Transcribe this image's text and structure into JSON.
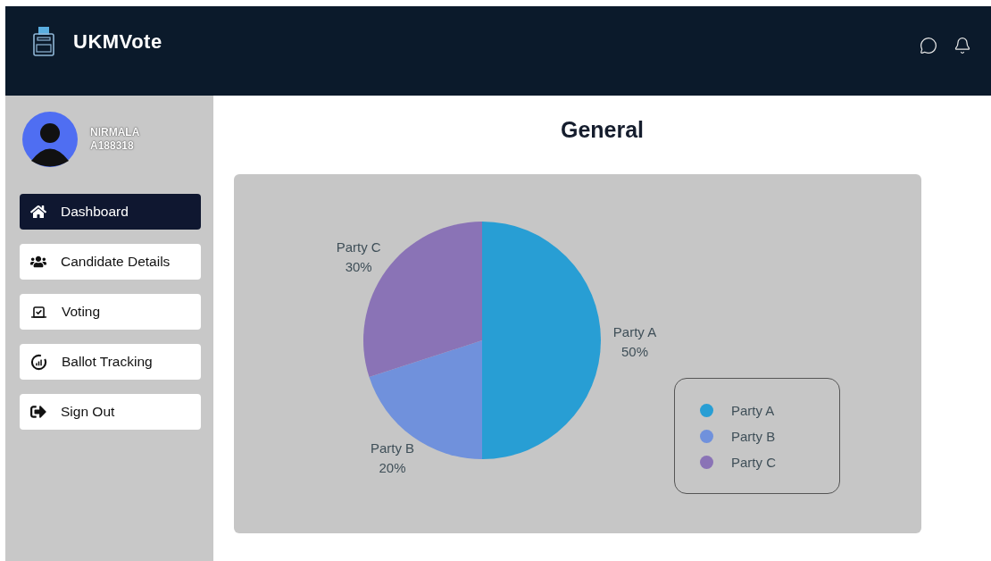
{
  "app": {
    "title": "UKMVote"
  },
  "user": {
    "name": "NIRMALA",
    "id": "A188318"
  },
  "sidebar": {
    "items": [
      {
        "label": "Dashboard",
        "kind": "home",
        "selected": true
      },
      {
        "label": "Candidate Details",
        "kind": "users",
        "selected": false
      },
      {
        "label": "Voting",
        "kind": "ballot",
        "selected": false
      },
      {
        "label": "Ballot Tracking",
        "kind": "tracking",
        "selected": false
      },
      {
        "label": "Sign Out",
        "kind": "signout",
        "selected": false
      }
    ]
  },
  "main": {
    "title": "General",
    "chart": {
      "chart_data": {
        "type": "pie",
        "categories": [
          "Party A",
          "Party B",
          "Party C"
        ],
        "series": [
          {
            "values": [
              50,
              20,
              30
            ]
          }
        ],
        "value_labels": [
          "50%",
          "20%",
          "30%"
        ]
      },
      "legend": [
        {
          "label": "Party A",
          "color": "#289ed4"
        },
        {
          "label": "Party B",
          "color": "#7091dc"
        },
        {
          "label": "Party C",
          "color": "#8a73b6"
        }
      ]
    }
  }
}
